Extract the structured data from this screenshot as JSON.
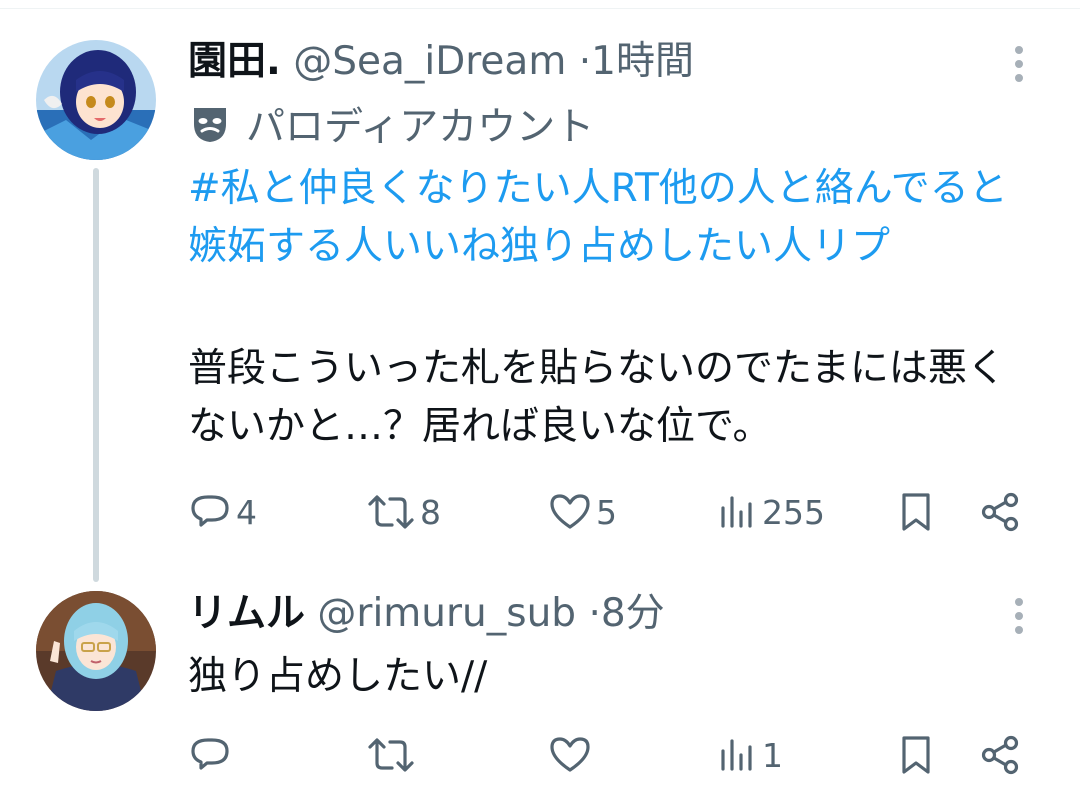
{
  "tweets": [
    {
      "display_name": "園田.",
      "handle": "@Sea_iDream",
      "separator": "·",
      "time": "1時間",
      "account_label": "パロディアカウント",
      "hashtag_text": "#私と仲良くなりたい人RT他の人と絡んでると嫉妬する人いいね独り占めしたい人リプ",
      "body": "普段こういった札を貼らないのでたまには悪くないかと…？居れば良いな位で。",
      "replies": "4",
      "retweets": "8",
      "likes": "5",
      "views": "255",
      "avatar_icon": "anime-avatar-blue-hair"
    },
    {
      "display_name": "リムル",
      "handle": "@rimuru_sub",
      "separator": "·",
      "time": "8分",
      "body": "独り占めしたい//",
      "replies": "",
      "retweets": "",
      "likes": "",
      "views": "1",
      "avatar_icon": "anime-avatar-light-blue-hair"
    }
  ],
  "colors": {
    "link": "#1d9bf0",
    "text": "#0f1419",
    "muted": "#536471",
    "thread_line": "#cfd9de"
  }
}
